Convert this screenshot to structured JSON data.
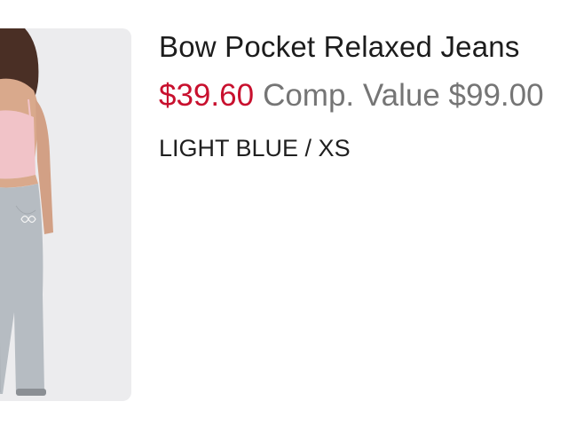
{
  "product": {
    "title": "Bow Pocket Relaxed Jeans",
    "price": "$39.60",
    "comp_value": "Comp. Value $99.00",
    "variant": "LIGHT BLUE / XS",
    "image_alt": "product-photo"
  },
  "colors": {
    "price": "#c8102e",
    "comp_value": "#757575",
    "title": "#1c1c1c",
    "image_background": "#ececee"
  }
}
